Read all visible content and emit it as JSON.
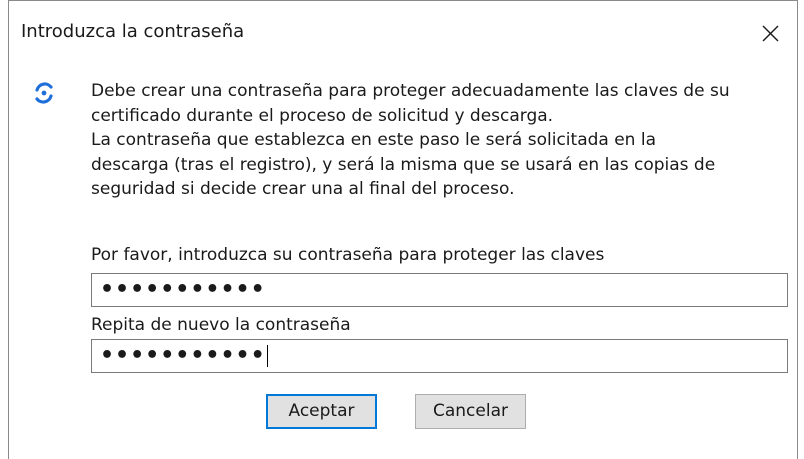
{
  "dialog": {
    "title": "Introduzca la contraseña",
    "close_icon": "close-icon",
    "app_icon": "certificate-app-icon"
  },
  "message": {
    "lines": [
      "Debe crear una contraseña para proteger adecuadamente las claves de su",
      "certificado durante el proceso de solicitud y descarga.",
      "La contraseña que establezca en este paso le será solicitada en la",
      "descarga (tras el registro), y será la misma que se usará en las copias de",
      "seguridad si decide crear una al final del proceso."
    ]
  },
  "form": {
    "password_label": "Por favor, introduzca su contraseña para proteger las claves",
    "password_value": "•••••••••••",
    "confirm_label": "Repita de nuevo la contraseña",
    "confirm_value": "•••••••••••"
  },
  "buttons": {
    "ok_label": "Aceptar",
    "cancel_label": "Cancelar"
  },
  "colors": {
    "focus_border": "#0078d7",
    "button_face": "#e1e1e1",
    "icon_blue": "#1e6fd9"
  }
}
